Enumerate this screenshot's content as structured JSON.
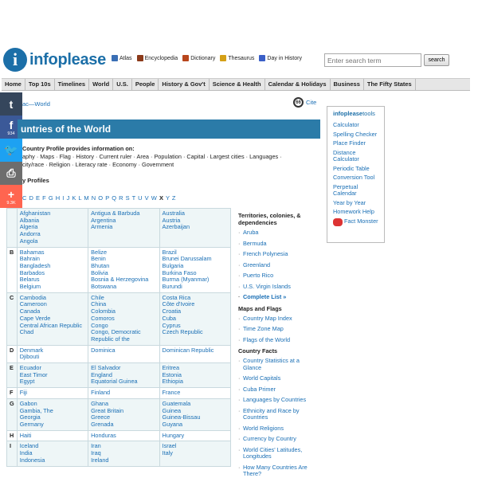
{
  "header": {
    "logo_letter": "i",
    "logo_text": "infoplease",
    "quick_links": [
      {
        "label": "Atlas",
        "icon": "globe-icon",
        "color": "#3a6fb5"
      },
      {
        "label": "Encyclopedia",
        "icon": "books-icon",
        "color": "#8b3a1a"
      },
      {
        "label": "Dictionary",
        "icon": "book-icon",
        "color": "#b8461c"
      },
      {
        "label": "Thesaurus",
        "icon": "thesaurus-icon",
        "color": "#d4a017"
      },
      {
        "label": "Day in History",
        "icon": "calendar-icon",
        "color": "#3a5fc7"
      }
    ],
    "search_placeholder": "Enter search term",
    "search_button": "search"
  },
  "nav": [
    "Home",
    "Top 10s",
    "Timelines",
    "World",
    "U.S.",
    "People",
    "History & Gov't",
    "Science & Health",
    "Calendar & Holidays",
    "Business",
    "The Fifty States"
  ],
  "social": [
    {
      "glyph": "t",
      "count": "",
      "color": "#35465c"
    },
    {
      "glyph": "f",
      "count": "934",
      "color": "#3b5998"
    },
    {
      "glyph": "🐦",
      "count": "",
      "color": "#1da1f2"
    },
    {
      "glyph": "⎙",
      "count": "",
      "color": "#6d6d6d"
    },
    {
      "glyph": "+",
      "count": "9.3K",
      "color": "#ff6550"
    }
  ],
  "breadcrumb": "ac—World",
  "cite": {
    "icon_text": "66",
    "label": "Cite"
  },
  "title": "untries of the World",
  "intro_bold": "Country Profile provides information on:",
  "intro_line1": "aphy · Maps · Flag · History · Current ruler · Area · Population · Capital · Largest cities · Languages ·",
  "intro_line2": "city/race · Religion · Literacy rate · Economy · Government",
  "profiles_label": "y Profiles",
  "alphabet": [
    "C",
    "D",
    "E",
    "F",
    "G",
    "H",
    "I",
    "J",
    "K",
    "L",
    "M",
    "N",
    "O",
    "P",
    "Q",
    "R",
    "S",
    "T",
    "U",
    "V",
    "W",
    "X",
    "Y",
    "Z"
  ],
  "alphabet_prefix": "",
  "rows": [
    {
      "letter": "",
      "cols": [
        [
          "Afghanistan",
          "Albania",
          "Algeria",
          "Andorra",
          "Angola"
        ],
        [
          "Antigua & Barbuda",
          "Argentina",
          "Armenia"
        ],
        [
          "Australia",
          "Austria",
          "Azerbaijan"
        ]
      ]
    },
    {
      "letter": "B",
      "cols": [
        [
          "Bahamas",
          "Bahrain",
          "Bangladesh",
          "Barbados",
          "Belarus",
          "Belgium"
        ],
        [
          "Belize",
          "Benin",
          "Bhutan",
          "Bolivia",
          "Bosnia & Herzegovina",
          "Botswana"
        ],
        [
          "Brazil",
          "Brunei Darussalam",
          "Bulgaria",
          "Burkina Faso",
          "Burma (Myanmar)",
          "Burundi"
        ]
      ]
    },
    {
      "letter": "C",
      "cols": [
        [
          "Cambodia",
          "Cameroon",
          "Canada",
          "Cape Verde",
          "Central African Republic",
          "Chad"
        ],
        [
          "Chile",
          "China",
          "Colombia",
          "Comoros",
          "Congo",
          "Congo, Democratic Republic of the"
        ],
        [
          "Costa Rica",
          "Côte d'Ivoire",
          "Croatia",
          "Cuba",
          "Cyprus",
          "Czech Republic"
        ]
      ]
    },
    {
      "letter": "D",
      "cols": [
        [
          "Denmark",
          "Djibouti"
        ],
        [
          "Dominica"
        ],
        [
          "Dominican Republic"
        ]
      ]
    },
    {
      "letter": "E",
      "cols": [
        [
          "Ecuador",
          "East Timor",
          "Egypt"
        ],
        [
          "El Salvador",
          "England",
          "Equatorial Guinea"
        ],
        [
          "Eritrea",
          "Estonia",
          "Ethiopia"
        ]
      ]
    },
    {
      "letter": "F",
      "cols": [
        [
          "Fiji"
        ],
        [
          "Finland"
        ],
        [
          "France"
        ]
      ]
    },
    {
      "letter": "G",
      "cols": [
        [
          "Gabon",
          "Gambia, The",
          "Georgia",
          "Germany"
        ],
        [
          "Ghana",
          "Great Britain",
          "Greece",
          "Grenada"
        ],
        [
          "Guatemala",
          "Guinea",
          "Guinea-Bissau",
          "Guyana"
        ]
      ]
    },
    {
      "letter": "H",
      "cols": [
        [
          "Haiti"
        ],
        [
          "Honduras"
        ],
        [
          "Hungary"
        ]
      ]
    },
    {
      "letter": "I",
      "cols": [
        [
          "Iceland",
          "India",
          "Indonesia"
        ],
        [
          "Iran",
          "Iraq",
          "Ireland"
        ],
        [
          "Israel",
          "Italy"
        ]
      ]
    }
  ],
  "middle": [
    {
      "heading": "Territories, colonies, & dependencies",
      "links": [
        "Aruba",
        "Bermuda",
        "French Polynesia",
        "Greenland",
        "Puerto Rico",
        "U.S. Virgin Islands"
      ],
      "bold": "Complete List »"
    },
    {
      "heading": "Maps and Flags",
      "links": [
        "Country Map Index",
        "Time Zone Map",
        "Flags of the World"
      ],
      "bold": ""
    },
    {
      "heading": "Country Facts",
      "links": [
        "Country Statistics at a Glance",
        "World Capitals",
        "Cuba Primer",
        "Languages by Countries",
        "Ethnicity and Race by Countries",
        "World Religions",
        "Currency by Country",
        "World Cities' Latitudes, Longitudes",
        "How Many Countries Are There?"
      ],
      "bold": ""
    }
  ],
  "tools": {
    "head_a": "infoplease",
    "head_b": "tools",
    "links": [
      "Calculator",
      "Spelling Checker",
      "Place Finder",
      "Distance Calculator",
      "Periodic Table",
      "Conversion Tool",
      "Perpetual Calendar",
      "Year by Year",
      "Homework Help"
    ],
    "fact_monster": "Fact Monster"
  }
}
